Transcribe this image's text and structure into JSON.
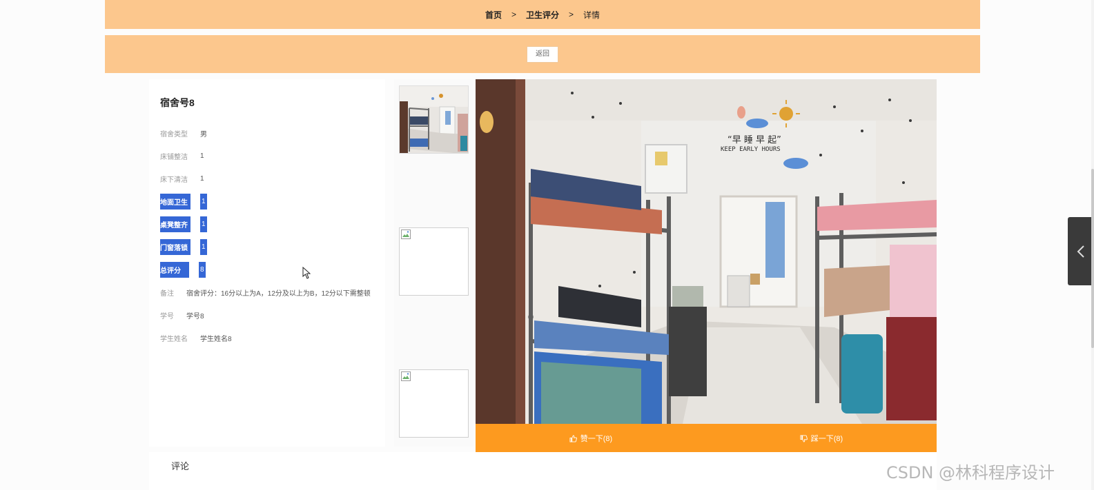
{
  "breadcrumb": {
    "home": "首页",
    "section": "卫生评分",
    "current": "详情",
    "separator": ">"
  },
  "actions": {
    "back_label": "返回"
  },
  "dorm": {
    "title": "宿舍号8",
    "fields": [
      {
        "label": "宿舍类型",
        "value": "男",
        "highlighted": false
      },
      {
        "label": "床铺整洁",
        "value": "1",
        "highlighted": false
      },
      {
        "label": "床下清洁",
        "value": "1",
        "highlighted": false
      },
      {
        "label": "地面卫生",
        "value": "1",
        "highlighted": true
      },
      {
        "label": "桌凳整齐",
        "value": "1",
        "highlighted": true
      },
      {
        "label": "门窗落锁",
        "value": "1",
        "highlighted": true
      },
      {
        "label": "总评分",
        "value": "8",
        "highlighted": true
      },
      {
        "label": "备注",
        "value": "宿舍评分：16分以上为A，12分及以上为B，12分以下需整顿",
        "highlighted": false
      },
      {
        "label": "学号",
        "value": "学号8",
        "highlighted": false
      },
      {
        "label": "学生姓名",
        "value": "学生姓名8",
        "highlighted": false
      }
    ]
  },
  "gallery": {
    "thumbnails": [
      "dorm-photo-thumb",
      "broken-image",
      "broken-image"
    ],
    "main_photo": "dorm-room-photo",
    "wall_text": "KEEP EARLY HOURS",
    "wall_slogan": "“早 睡 早 起”"
  },
  "votes": {
    "like_label": "赞一下(8)",
    "dislike_label": "踩一下(8)"
  },
  "comments": {
    "title": "评论"
  },
  "watermark": "CSDN @林科程序设计",
  "colors": {
    "banner": "#fcc78d",
    "vote_bar": "#fd9a1f",
    "selection": "#3567d6"
  }
}
